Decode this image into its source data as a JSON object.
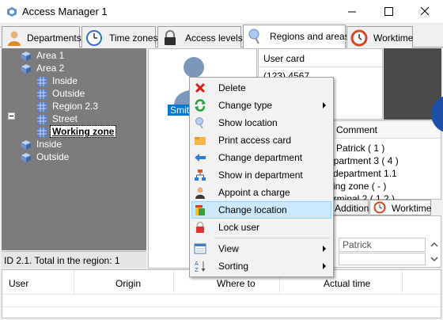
{
  "window": {
    "title": "Access Manager 1"
  },
  "tabs": [
    {
      "label": "Departments",
      "icon": "user-icon"
    },
    {
      "label": "Time zones",
      "icon": "clock-icon"
    },
    {
      "label": "Access levels",
      "icon": "lock-icon"
    },
    {
      "label": "Regions and areas",
      "icon": "pin-icon",
      "active": true
    },
    {
      "label": "Worktime",
      "icon": "worktime-clock-icon"
    }
  ],
  "tree": {
    "items": [
      {
        "label": "Area 1",
        "kind": "area"
      },
      {
        "label": "Area 2",
        "kind": "area",
        "expanded": true
      },
      {
        "label": "Inside",
        "kind": "zone"
      },
      {
        "label": "Outside",
        "kind": "zone"
      },
      {
        "label": "Region 2.3",
        "kind": "zone"
      },
      {
        "label": "Street",
        "kind": "zone"
      },
      {
        "label": "Working zone",
        "kind": "zone",
        "selected": true
      },
      {
        "label": "Inside",
        "kind": "area"
      },
      {
        "label": "Outside",
        "kind": "area"
      }
    ],
    "status": "ID 2.1. Total in the region: 1"
  },
  "photo": {
    "name": "Smith"
  },
  "user_card": {
    "title": "User card",
    "number": "(123) 4567"
  },
  "comment_grid": {
    "header": "Comment",
    "rows": [
      "n Patrick ( 1 )",
      "epartment 3 ( 4 )",
      "l department 1.1",
      "king zone ( - )",
      "erminal 2 ( 1.2 )"
    ]
  },
  "sub_tabs": {
    "additional": "Additional",
    "worktime": "Worktime"
  },
  "sub_fields": {
    "first_name": "Patrick"
  },
  "bottom_table": {
    "columns": [
      "User",
      "Origin",
      "Where to",
      "Actual time"
    ]
  },
  "context_menu": {
    "items": [
      {
        "label": "Delete",
        "icon": "delete-x-icon"
      },
      {
        "label": "Change type",
        "icon": "change-type-icon",
        "submenu": true
      },
      {
        "label": "Show location",
        "icon": "show-location-pin-icon"
      },
      {
        "label": "Print access card",
        "icon": "print-card-icon"
      },
      {
        "label": "Change department",
        "icon": "arrow-change-department-icon"
      },
      {
        "label": "Show in department",
        "icon": "department-tree-icon"
      },
      {
        "label": "Appoint a charge",
        "icon": "appoint-charge-icon"
      },
      {
        "label": "Change location",
        "icon": "change-location-icon",
        "highlighted": true
      },
      {
        "label": "Lock user",
        "icon": "lock-user-icon"
      },
      {
        "label": "View",
        "icon": "view-icon",
        "submenu": true
      },
      {
        "label": "Sorting",
        "icon": "sort-icon",
        "submenu": true
      }
    ]
  },
  "colors": {
    "selection": "#0078d7",
    "menu_highlight": "#cce8ff",
    "tree_bg": "#7c7c7c"
  }
}
